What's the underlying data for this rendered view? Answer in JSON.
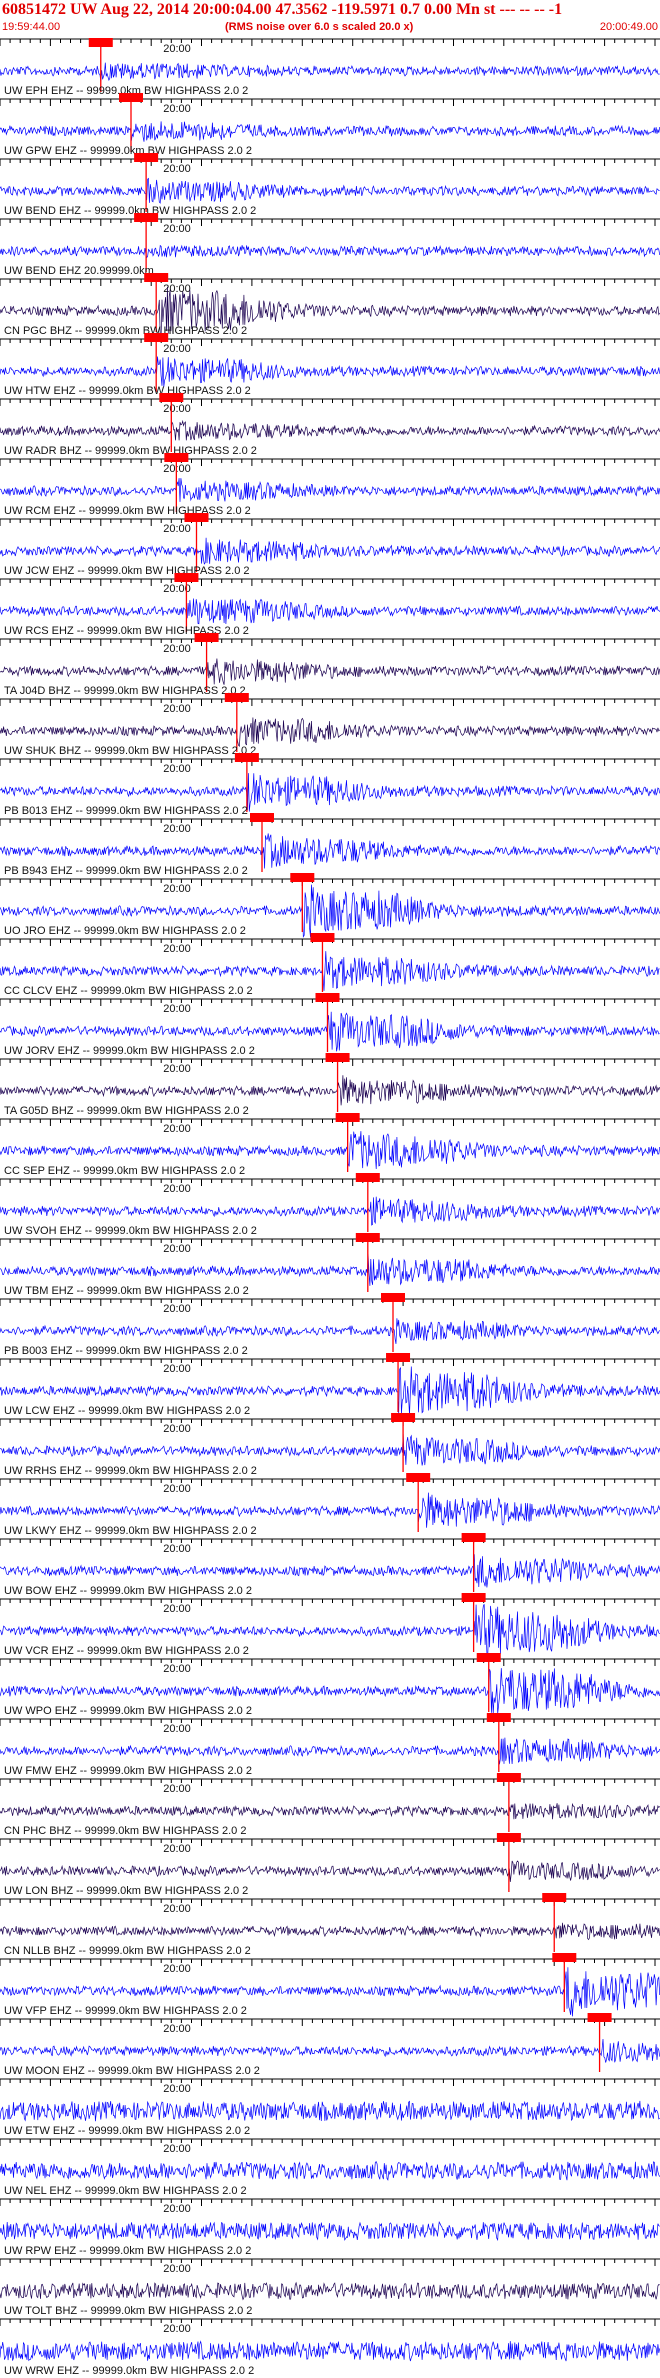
{
  "header": {
    "title": "60851472 UW Aug 22, 2014 20:00:04.00   47.3562 -119.5971  0.7 0.00 Mn st --- -- --   -1",
    "start_time": "19:59:44.00",
    "note": "(RMS noise over 6.0 s scaled 20.0 x)",
    "end_time": "20:00:49.00"
  },
  "colors": {
    "trace_blue": "#0000ff",
    "trace_dark": "#1a0050",
    "pick": "#ff0000",
    "axis": "#000000"
  },
  "chart_data": {
    "type": "line",
    "title": "60851472 UW Aug 22, 2014 20:00:04.00   47.3562 -119.5971  0.7 0.00 Mn st --- -- --   -1",
    "x_unit": "s",
    "xlim": [
      0,
      65
    ],
    "tick_label": "20:00",
    "tick_label_time_s": 16,
    "traces": [
      {
        "label": "UW EPH EHZ -- 99999.0km BW  HIGHPASS  2.0  2",
        "pick_s": 10.0,
        "color": "blue",
        "amp": 0.22
      },
      {
        "label": "UW GPW EHZ -- 99999.0km BW  HIGHPASS  2.0  2",
        "pick_s": 13.0,
        "color": "blue",
        "amp": 0.3
      },
      {
        "label": "UW BEND EHZ -- 99999.0km BW  HIGHPASS  2.0  2",
        "pick_s": 14.5,
        "color": "blue",
        "amp": 0.35
      },
      {
        "label": "UW BEND EHZ 20.99999.0km",
        "pick_s": 14.5,
        "color": "blue",
        "amp": 0.08
      },
      {
        "label": "CN PGC BHZ -- 99999.0km BW  HIGHPASS  2.0  2",
        "pick_s": 15.5,
        "color": "dark",
        "amp": 0.9
      },
      {
        "label": "UW HTW EHZ -- 99999.0km BW  HIGHPASS  2.0  2",
        "pick_s": 15.5,
        "color": "blue",
        "amp": 0.45
      },
      {
        "label": "UW RADR BHZ -- 99999.0km BW  HIGHPASS  2.0  2",
        "pick_s": 17.0,
        "color": "dark",
        "amp": 0.25
      },
      {
        "label": "UW RCM EHZ -- 99999.0km BW  HIGHPASS  2.0  2",
        "pick_s": 17.5,
        "color": "blue",
        "amp": 0.3
      },
      {
        "label": "UW JCW EHZ -- 99999.0km BW  HIGHPASS  2.0  2",
        "pick_s": 19.5,
        "color": "blue",
        "amp": 0.4
      },
      {
        "label": "UW RCS EHZ -- 99999.0km BW  HIGHPASS  2.0  2",
        "pick_s": 18.5,
        "color": "blue",
        "amp": 0.45
      },
      {
        "label": "TA J04D BHZ -- 99999.0km BW  HIGHPASS  2.0  2",
        "pick_s": 20.5,
        "color": "dark",
        "amp": 0.4
      },
      {
        "label": "UW SHUK BHZ -- 99999.0km BW  HIGHPASS  2.0  2",
        "pick_s": 23.5,
        "color": "dark",
        "amp": 0.45
      },
      {
        "label": "PB B013 EHZ -- 99999.0km BW  HIGHPASS  2.0  2",
        "pick_s": 24.5,
        "color": "blue",
        "amp": 0.6
      },
      {
        "label": "PB B943 EHZ -- 99999.0km BW  HIGHPASS  2.0  2",
        "pick_s": 26.0,
        "color": "blue",
        "amp": 0.55
      },
      {
        "label": "UO JRO EHZ -- 99999.0km BW  HIGHPASS  2.0  2",
        "pick_s": 30.0,
        "color": "blue",
        "amp": 0.9
      },
      {
        "label": "CC CLCV EHZ -- 99999.0km BW  HIGHPASS  2.0  2",
        "pick_s": 32.0,
        "color": "blue",
        "amp": 0.6
      },
      {
        "label": "UW JORV EHZ -- 99999.0km BW  HIGHPASS  2.0  2",
        "pick_s": 32.5,
        "color": "blue",
        "amp": 0.7
      },
      {
        "label": "TA G05D BHZ -- 99999.0km BW  HIGHPASS  2.0  2",
        "pick_s": 33.5,
        "color": "dark",
        "amp": 0.45
      },
      {
        "label": "CC SEP EHZ -- 99999.0km BW  HIGHPASS  2.0  2",
        "pick_s": 34.5,
        "color": "blue",
        "amp": 0.7
      },
      {
        "label": "UW SVOH EHZ -- 99999.0km BW  HIGHPASS  2.0  2",
        "pick_s": 36.5,
        "color": "blue",
        "amp": 0.4
      },
      {
        "label": "UW TBM EHZ -- 99999.0km BW  HIGHPASS  2.0  2",
        "pick_s": 36.5,
        "color": "blue",
        "amp": 0.5
      },
      {
        "label": "PB B003 EHZ -- 99999.0km BW  HIGHPASS  2.0  2",
        "pick_s": 39.0,
        "color": "blue",
        "amp": 0.3
      },
      {
        "label": "UW LCW EHZ -- 99999.0km BW  HIGHPASS  2.0  2",
        "pick_s": 39.5,
        "color": "blue",
        "amp": 0.9
      },
      {
        "label": "UW RRHS EHZ -- 99999.0km BW  HIGHPASS  2.0  2",
        "pick_s": 40.0,
        "color": "blue",
        "amp": 0.5
      },
      {
        "label": "UW LKWY EHZ -- 99999.0km BW  HIGHPASS  2.0  2",
        "pick_s": 41.5,
        "color": "blue",
        "amp": 0.6
      },
      {
        "label": "UW BOW EHZ -- 99999.0km BW  HIGHPASS  2.0  2",
        "pick_s": 47.0,
        "color": "blue",
        "amp": 0.55
      },
      {
        "label": "UW VCR EHZ -- 99999.0km BW  HIGHPASS  2.0  2",
        "pick_s": 47.0,
        "color": "blue",
        "amp": 1.0
      },
      {
        "label": "UW WPO EHZ -- 99999.0km BW  HIGHPASS  2.0  2",
        "pick_s": 48.5,
        "color": "blue",
        "amp": 1.0
      },
      {
        "label": "UW FMW EHZ -- 99999.0km BW  HIGHPASS  2.0  2",
        "pick_s": 49.5,
        "color": "blue",
        "amp": 0.4
      },
      {
        "label": "CN PHC BHZ -- 99999.0km BW  HIGHPASS  2.0  2",
        "pick_s": 50.5,
        "color": "dark",
        "amp": 0.2
      },
      {
        "label": "UW LON BHZ -- 99999.0km BW  HIGHPASS  2.0  2",
        "pick_s": 50.5,
        "color": "dark",
        "amp": 0.25
      },
      {
        "label": "CN NLLB BHZ -- 99999.0km BW  HIGHPASS  2.0  2",
        "pick_s": 55.0,
        "color": "dark",
        "amp": 0.2
      },
      {
        "label": "UW VFP EHZ -- 99999.0km BW  HIGHPASS  2.0  2",
        "pick_s": 56.0,
        "color": "blue",
        "amp": 0.9
      },
      {
        "label": "UW MOON EHZ -- 99999.0km BW  HIGHPASS  2.0  2",
        "pick_s": 59.5,
        "color": "blue",
        "amp": 0.35
      },
      {
        "label": "UW ETW EHZ -- 99999.0km BW  HIGHPASS  2.0  2",
        "pick_s": null,
        "color": "blue",
        "amp": 0.3
      },
      {
        "label": "UW NEL EHZ -- 99999.0km BW  HIGHPASS  2.0  2",
        "pick_s": null,
        "color": "blue",
        "amp": 0.25
      },
      {
        "label": "UW RPW EHZ -- 99999.0km BW  HIGHPASS  2.0  2",
        "pick_s": null,
        "color": "blue",
        "amp": 0.25
      },
      {
        "label": "UW TOLT BHZ -- 99999.0km BW  HIGHPASS  2.0  2",
        "pick_s": null,
        "color": "dark",
        "amp": 0.2
      },
      {
        "label": "UW WRW EHZ -- 99999.0km BW  HIGHPASS  2.0  2",
        "pick_s": null,
        "color": "blue",
        "amp": 0.3
      }
    ]
  }
}
